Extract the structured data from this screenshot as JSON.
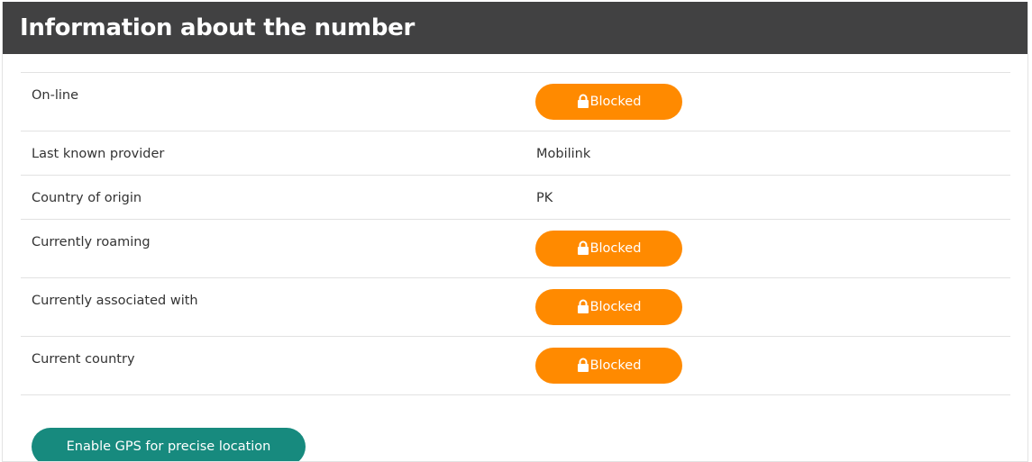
{
  "header": {
    "title": "Information about the number"
  },
  "rows": [
    {
      "label": "On-line",
      "value": "Blocked",
      "type": "button"
    },
    {
      "label": "Last known provider",
      "value": "Mobilink",
      "type": "text"
    },
    {
      "label": "Country of origin",
      "value": "PK",
      "type": "text"
    },
    {
      "label": "Currently roaming",
      "value": "Blocked",
      "type": "button"
    },
    {
      "label": "Currently associated with",
      "value": "Blocked",
      "type": "button"
    },
    {
      "label": "Current country",
      "value": "Blocked",
      "type": "button"
    }
  ],
  "gps_button": {
    "label": "Enable GPS for precise location"
  },
  "icons": {
    "blocked": "lock-icon"
  },
  "colors": {
    "header_bg": "#414142",
    "blocked_button": "#ff8a00",
    "gps_button": "#178a7e"
  }
}
